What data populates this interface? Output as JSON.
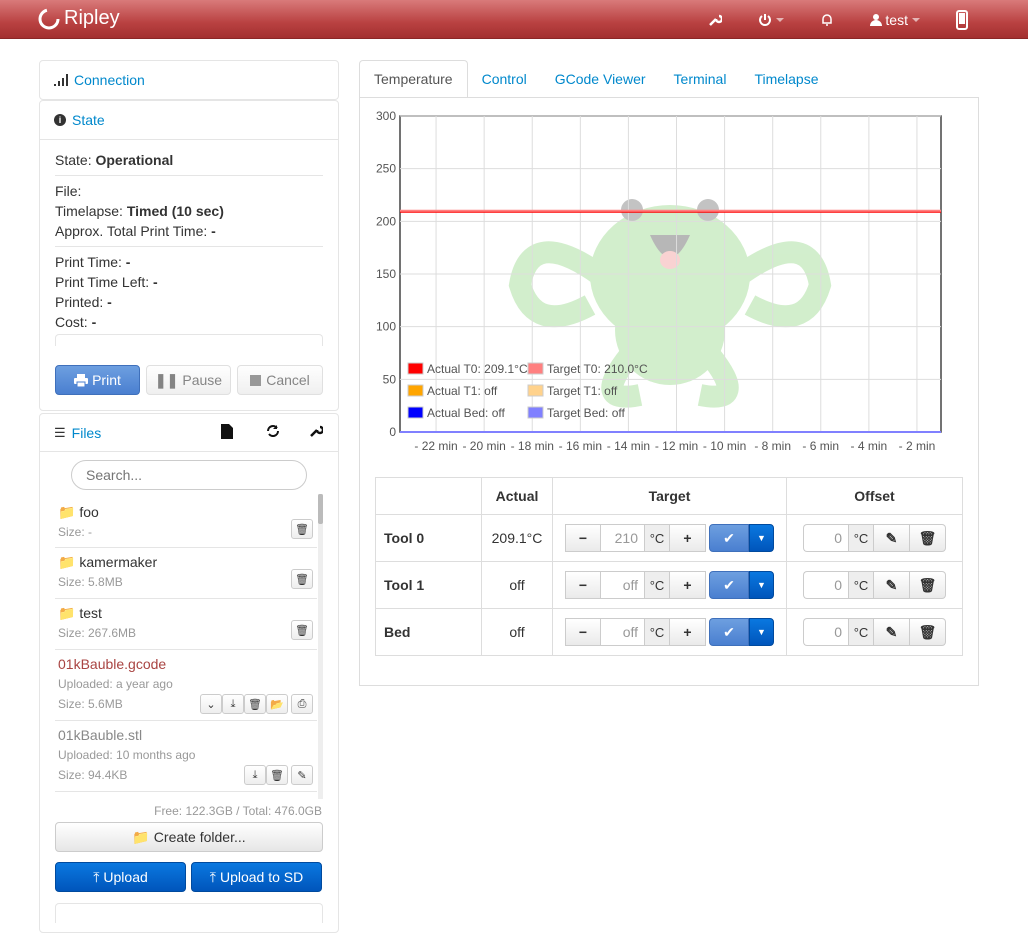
{
  "navbar": {
    "brand": "Ripley",
    "user": "test"
  },
  "connection": {
    "title": "Connection"
  },
  "state": {
    "title": "State",
    "state_label": "State:",
    "state_value": "Operational",
    "file_label": "File:",
    "timelapse_label": "Timelapse:",
    "timelapse_value": "Timed (10 sec)",
    "approx_label": "Approx. Total Print Time:",
    "approx_value": "-",
    "print_time_label": "Print Time:",
    "print_time_value": "-",
    "print_left_label": "Print Time Left:",
    "print_left_value": "-",
    "printed_label": "Printed:",
    "printed_value": "-",
    "cost_label": "Cost:",
    "cost_value": "-",
    "print_btn": "Print",
    "pause_btn": "Pause",
    "cancel_btn": "Cancel"
  },
  "files": {
    "title": "Files",
    "search_placeholder": "Search...",
    "entries": [
      {
        "name": "foo",
        "size": "Size: -"
      },
      {
        "name": "kamermaker",
        "size": "Size: 5.8MB"
      },
      {
        "name": "test",
        "size": "Size: 267.6MB"
      },
      {
        "name": "01kBauble.gcode",
        "uploaded": "Uploaded: a year ago",
        "size": "Size: 5.6MB"
      },
      {
        "name": "01kBauble.stl",
        "uploaded": "Uploaded: 10 months ago",
        "size": "Size: 94.4KB"
      }
    ],
    "free": "Free: 122.3GB / Total: 476.0GB",
    "create_folder": "Create folder...",
    "upload": "Upload",
    "upload_sd": "Upload to SD"
  },
  "tabs": [
    "Temperature",
    "Control",
    "GCode Viewer",
    "Terminal",
    "Timelapse"
  ],
  "chart_data": {
    "type": "line",
    "x_ticks": [
      "- 22 min",
      "- 20 min",
      "- 18 min",
      "- 16 min",
      "- 14 min",
      "- 12 min",
      "- 10 min",
      "- 8 min",
      "- 6 min",
      "- 4 min",
      "- 2 min"
    ],
    "y_ticks": [
      "300",
      "250",
      "200",
      "150",
      "100",
      "50",
      "0"
    ],
    "ylim": [
      0,
      300
    ],
    "xlim": [
      -23.5,
      -1
    ],
    "series": [
      {
        "name": "Actual T0: 209.1°C",
        "color": "#ff0000",
        "values": [
          209.1,
          209.1
        ]
      },
      {
        "name": "Target T0: 210.0°C",
        "color": "#ff8080",
        "values": [
          210,
          210
        ]
      },
      {
        "name": "Actual T1: off",
        "color": "#ffa500",
        "values": []
      },
      {
        "name": "Target T1: off",
        "color": "#ffd28c",
        "values": []
      },
      {
        "name": "Actual Bed: off",
        "color": "#0000ff",
        "values": [
          0,
          0
        ]
      },
      {
        "name": "Target Bed: off",
        "color": "#8080ff",
        "values": [
          0,
          0
        ]
      }
    ]
  },
  "temp_table": {
    "headers": [
      "",
      "Actual",
      "Target",
      "Offset"
    ],
    "rows": [
      {
        "name": "Tool 0",
        "actual": "209.1°C",
        "target": "210",
        "offset": "0",
        "unit": "°C"
      },
      {
        "name": "Tool 1",
        "actual": "off",
        "target": "off",
        "offset": "0",
        "unit": "°C"
      },
      {
        "name": "Bed",
        "actual": "off",
        "target": "off",
        "offset": "0",
        "unit": "°C"
      }
    ]
  }
}
